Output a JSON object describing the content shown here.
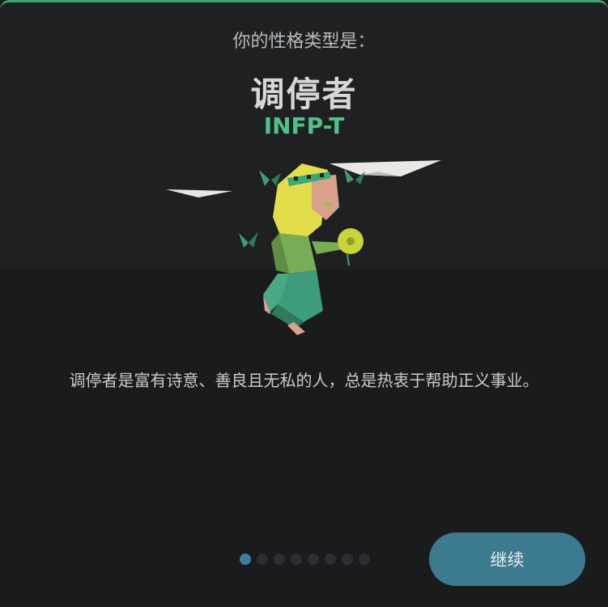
{
  "header": {
    "subtitle": "你的性格类型是：",
    "type_name": "调停者",
    "type_code": "INFP-T"
  },
  "illustration": {
    "icon": "mediator-character-illustration"
  },
  "description": "调停者是富有诗意、善良且无私的人，总是热衷于帮助正义事业。",
  "pagination": {
    "total": 8,
    "active_index": 0
  },
  "actions": {
    "continue_label": "继续"
  },
  "colors": {
    "accent_green": "#4fc28b",
    "button_blue": "#3c7a90",
    "active_dot": "#3d7f99"
  }
}
